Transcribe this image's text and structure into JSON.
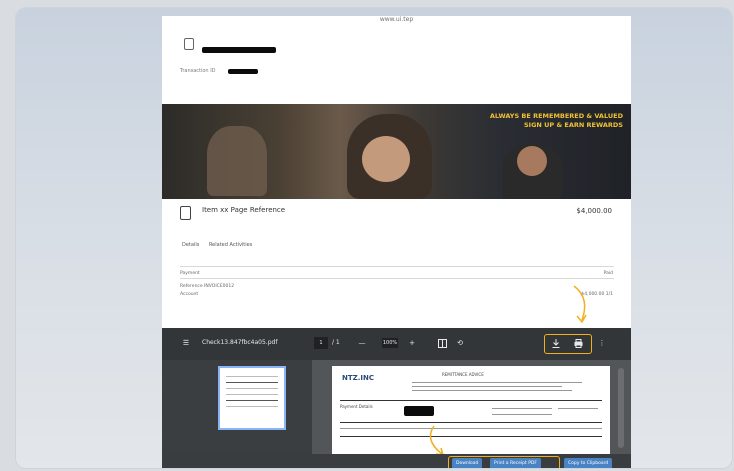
{
  "browser": {
    "url_text": "www.ui.tep",
    "header_subtitle": "Transaction ID"
  },
  "hero": {
    "caption_line1": "ALWAYS BE REMEMBERED & VALUED",
    "caption_line2": "SIGN UP & EARN REWARDS"
  },
  "item": {
    "title": "Item xx  Page Reference",
    "price": "$4,000.00"
  },
  "tabs": [
    "Details",
    "Related Activities"
  ],
  "details": {
    "label1": "Payment",
    "label1_right": "Paid",
    "label2": "Reference  INVOICE0012",
    "label2_sub": "Account",
    "label2_right": "$4,000.00  1/1"
  },
  "pdf_toolbar": {
    "filename": "Check13.847fbc4a05.pdf",
    "page_current": "1",
    "page_total": "/ 1",
    "zoom_minus": "—",
    "zoom_value": "100%",
    "zoom_plus": "+"
  },
  "pdf_page": {
    "brand": "NTZ.INC",
    "heading": "REMITTANCE ADVICE",
    "line_label": "Payment Details"
  },
  "bottom_buttons": {
    "download": "Download",
    "print": "Print a Receipt PDF",
    "share": "Copy to Clipboard"
  },
  "colors": {
    "highlight": "#f2b01e",
    "toolbar_bg": "#323639",
    "viewer_bg": "#525659",
    "thumb_border": "#8ab4f8",
    "bottom_btn_blue": "#4a83c4"
  },
  "icons": {
    "menu": "hamburger-menu-icon",
    "fit": "fit-page-icon",
    "rotate": "rotate-icon",
    "download": "download-icon",
    "print": "print-icon",
    "more": "more-vertical-icon"
  }
}
